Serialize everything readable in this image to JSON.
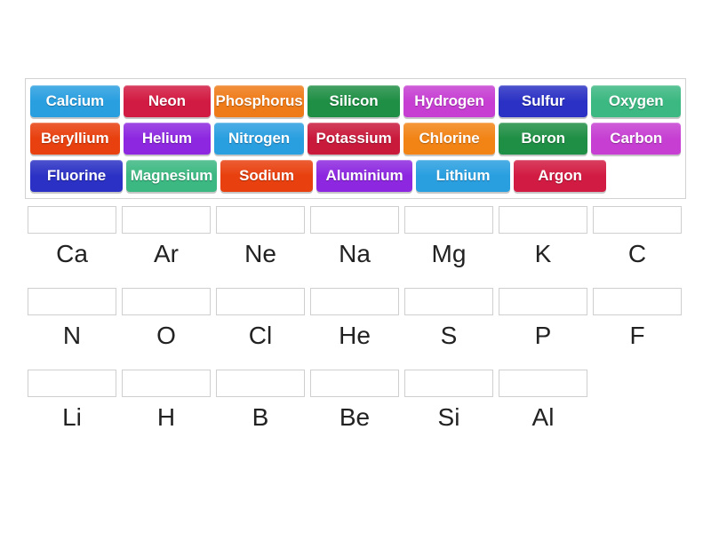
{
  "activity": {
    "type": "drag-and-drop-match",
    "tile_bank": {
      "rows": [
        [
          {
            "label": "Calcium",
            "color": "#2a9fe0"
          },
          {
            "label": "Neon",
            "color": "#d21b42"
          },
          {
            "label": "Phosphorus",
            "color": "#ef7b18"
          },
          {
            "label": "Silicon",
            "color": "#1f8f45"
          },
          {
            "label": "Hydrogen",
            "color": "#c63fd2"
          },
          {
            "label": "Sulfur",
            "color": "#2b31c4"
          },
          {
            "label": "Oxygen",
            "color": "#3cb882"
          }
        ],
        [
          {
            "label": "Beryllium",
            "color": "#e8400e"
          },
          {
            "label": "Helium",
            "color": "#8d28e0"
          },
          {
            "label": "Nitrogen",
            "color": "#2a9fe0"
          },
          {
            "label": "Potassium",
            "color": "#c91a3c"
          },
          {
            "label": "Chlorine",
            "color": "#f28416"
          },
          {
            "label": "Boron",
            "color": "#1f8f45"
          },
          {
            "label": "Carbon",
            "color": "#c63fd2"
          }
        ],
        [
          {
            "label": "Fluorine",
            "color": "#2b31c4"
          },
          {
            "label": "Magnesium",
            "color": "#3cb882"
          },
          {
            "label": "Sodium",
            "color": "#e8400e"
          },
          {
            "label": "Aluminium",
            "color": "#8d28e0"
          },
          {
            "label": "Lithium",
            "color": "#2a9fe0"
          },
          {
            "label": "Argon",
            "color": "#d21b42"
          }
        ]
      ]
    },
    "answer_grid": {
      "rows": [
        [
          {
            "symbol": "Ca",
            "dropped": ""
          },
          {
            "symbol": "Ar",
            "dropped": ""
          },
          {
            "symbol": "Ne",
            "dropped": ""
          },
          {
            "symbol": "Na",
            "dropped": ""
          },
          {
            "symbol": "Mg",
            "dropped": ""
          },
          {
            "symbol": "K",
            "dropped": ""
          },
          {
            "symbol": "C",
            "dropped": ""
          }
        ],
        [
          {
            "symbol": "N",
            "dropped": ""
          },
          {
            "symbol": "O",
            "dropped": ""
          },
          {
            "symbol": "Cl",
            "dropped": ""
          },
          {
            "symbol": "He",
            "dropped": ""
          },
          {
            "symbol": "S",
            "dropped": ""
          },
          {
            "symbol": "P",
            "dropped": ""
          },
          {
            "symbol": "F",
            "dropped": ""
          }
        ],
        [
          {
            "symbol": "Li",
            "dropped": ""
          },
          {
            "symbol": "H",
            "dropped": ""
          },
          {
            "symbol": "B",
            "dropped": ""
          },
          {
            "symbol": "Be",
            "dropped": ""
          },
          {
            "symbol": "Si",
            "dropped": ""
          },
          {
            "symbol": "Al",
            "dropped": ""
          }
        ]
      ]
    }
  },
  "colors": {
    "page_background": "#ffffff",
    "bank_border": "#d2d2d2",
    "dropzone_border": "#cfcfcf",
    "label_text": "#222222",
    "tile_text": "#ffffff"
  }
}
